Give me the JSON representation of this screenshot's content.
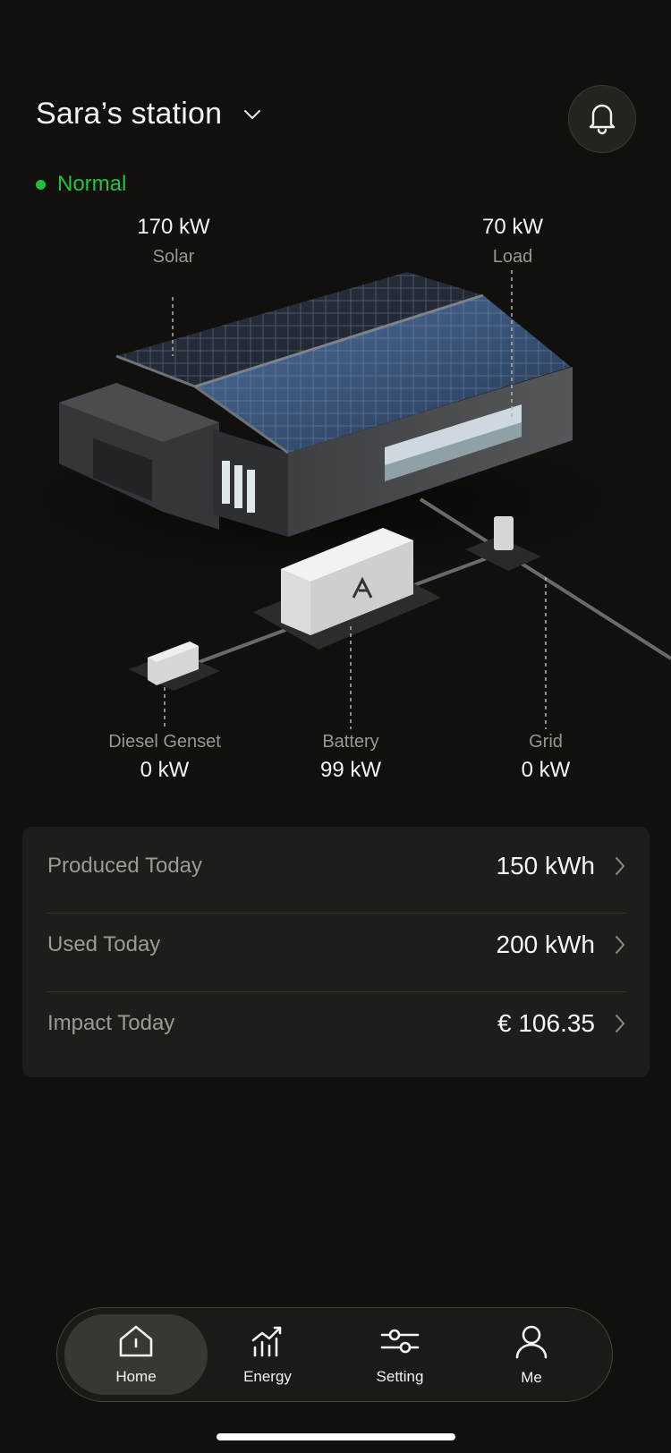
{
  "header": {
    "station_name": "Sara’s station",
    "status": "Normal",
    "status_color": "#22c33f"
  },
  "flow": {
    "solar": {
      "label": "Solar",
      "value": "170 kW"
    },
    "load": {
      "label": "Load",
      "value": "70 kW"
    },
    "diesel": {
      "label": "Diesel Genset",
      "value": "0 kW"
    },
    "battery": {
      "label": "Battery",
      "value": "99 kW"
    },
    "grid": {
      "label": "Grid",
      "value": "0 kW"
    }
  },
  "stats": [
    {
      "label": "Produced Today",
      "value": "150 kWh"
    },
    {
      "label": "Used Today",
      "value": "200 kWh"
    },
    {
      "label": "Impact Today",
      "value": "€ 106.35"
    }
  ],
  "tabbar": {
    "items": [
      {
        "label": "Home",
        "icon": "home-icon",
        "active": true
      },
      {
        "label": "Energy",
        "icon": "energy-chart-icon",
        "active": false
      },
      {
        "label": "Setting",
        "icon": "sliders-icon",
        "active": false
      },
      {
        "label": "Me",
        "icon": "user-icon",
        "active": false
      }
    ]
  }
}
